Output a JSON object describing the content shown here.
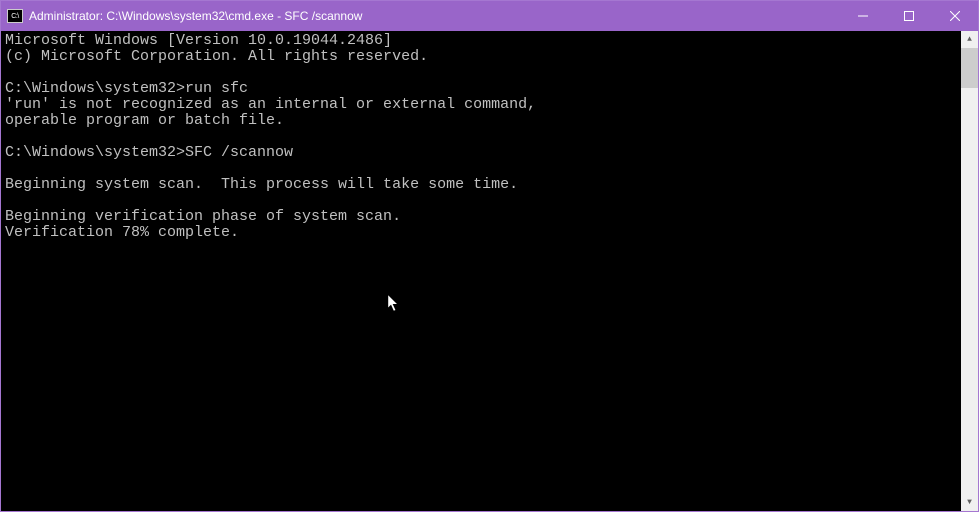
{
  "titlebar": {
    "icon_label": "C:\\",
    "title": "Administrator: C:\\Windows\\system32\\cmd.exe - SFC  /scannow"
  },
  "terminal": {
    "lines": [
      "Microsoft Windows [Version 10.0.19044.2486]",
      "(c) Microsoft Corporation. All rights reserved.",
      "",
      "C:\\Windows\\system32>run sfc",
      "'run' is not recognized as an internal or external command,",
      "operable program or batch file.",
      "",
      "C:\\Windows\\system32>SFC /scannow",
      "",
      "Beginning system scan.  This process will take some time.",
      "",
      "Beginning verification phase of system scan.",
      "Verification 78% complete."
    ]
  }
}
